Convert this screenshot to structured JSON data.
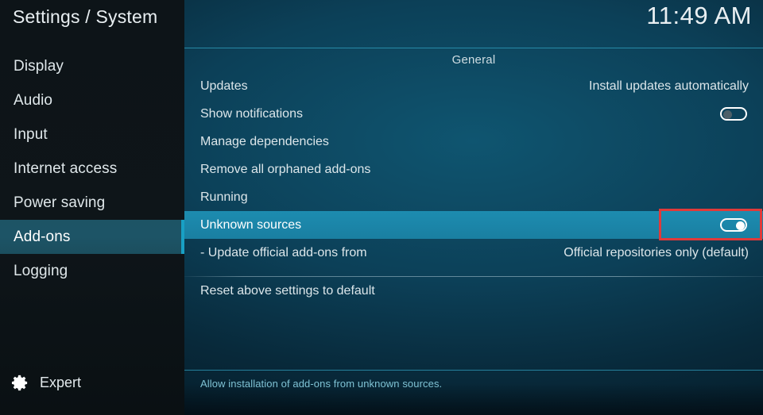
{
  "header": {
    "title": "Settings / System",
    "clock": "11:49 AM"
  },
  "sidebar": {
    "items": [
      {
        "label": "Display",
        "selected": false
      },
      {
        "label": "Audio",
        "selected": false
      },
      {
        "label": "Input",
        "selected": false
      },
      {
        "label": "Internet access",
        "selected": false
      },
      {
        "label": "Power saving",
        "selected": false
      },
      {
        "label": "Add-ons",
        "selected": true
      },
      {
        "label": "Logging",
        "selected": false
      }
    ],
    "footer": {
      "icon": "gear-icon",
      "label": "Expert"
    }
  },
  "main": {
    "section_title": "General",
    "rows": [
      {
        "label": "Updates",
        "value": "Install updates automatically",
        "control": "text",
        "highlight": false
      },
      {
        "label": "Show notifications",
        "value": "",
        "control": "toggle",
        "toggle_state": "off",
        "highlight": false
      },
      {
        "label": "Manage dependencies",
        "value": "",
        "control": "none",
        "highlight": false
      },
      {
        "label": "Remove all orphaned add-ons",
        "value": "",
        "control": "none",
        "highlight": false
      },
      {
        "label": "Running",
        "value": "",
        "control": "none",
        "highlight": false
      },
      {
        "label": "Unknown sources",
        "value": "",
        "control": "toggle",
        "toggle_state": "on",
        "highlight": true,
        "annotated": true
      },
      {
        "label": "- Update official add-ons from",
        "value": "Official repositories only (default)",
        "control": "text",
        "highlight": false
      },
      {
        "label": "Reset above settings to default",
        "value": "",
        "control": "none",
        "highlight": false
      }
    ],
    "help_text": "Allow installation of add-ons from unknown sources."
  },
  "colors": {
    "accent": "#18a0c4",
    "highlight_row": "#1b85a8",
    "sidebar_selected": "#1d5466",
    "annotation": "#e03a3a",
    "help_text": "#7fc2d4"
  }
}
